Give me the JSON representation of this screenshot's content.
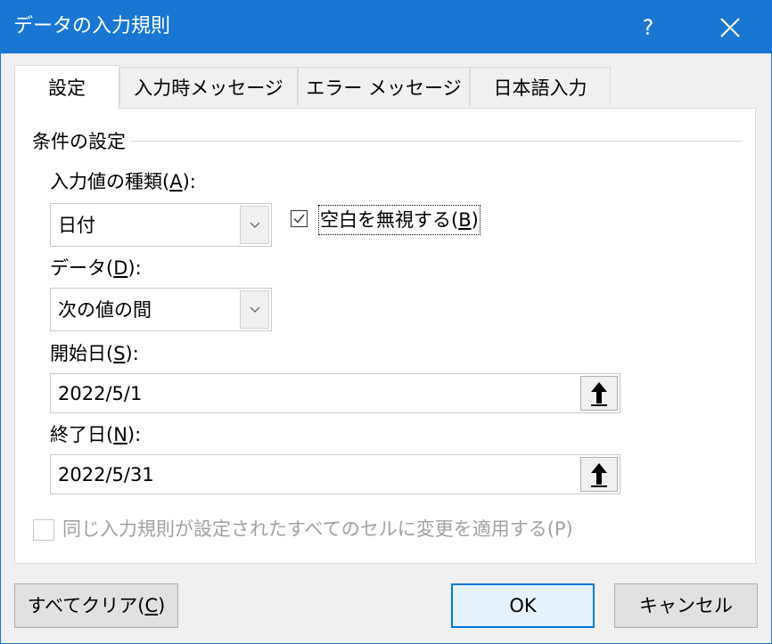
{
  "window": {
    "title": "データの入力規則",
    "help_label": "?"
  },
  "tabs": [
    {
      "label": "設定",
      "active": true
    },
    {
      "label": "入力時メッセージ",
      "active": false
    },
    {
      "label": "エラー メッセージ",
      "active": false
    },
    {
      "label": "日本語入力",
      "active": false
    }
  ],
  "conditions": {
    "group_title": "条件の設定",
    "allow": {
      "label_prefix": "入力値の種類(",
      "label_key": "A",
      "label_suffix": "):",
      "value": "日付"
    },
    "ignore_blank": {
      "label_prefix": "空白を無視する(",
      "label_key": "B",
      "label_suffix": ")",
      "checked": true
    },
    "data": {
      "label_prefix": "データ(",
      "label_key": "D",
      "label_suffix": "):",
      "value": "次の値の間"
    },
    "start_date": {
      "label_prefix": "開始日(",
      "label_key": "S",
      "label_suffix": "):",
      "value": "2022/5/1"
    },
    "end_date": {
      "label_prefix": "終了日(",
      "label_key": "N",
      "label_suffix": "):",
      "value": "2022/5/31"
    },
    "apply_all": {
      "label": "同じ入力規則が設定されたすべてのセルに変更を適用する(P)",
      "checked": false,
      "disabled": true
    }
  },
  "buttons": {
    "clear_all_prefix": "すべてクリア(",
    "clear_all_key": "C",
    "clear_all_suffix": ")",
    "ok": "OK",
    "cancel": "キャンセル"
  },
  "colors": {
    "titlebar": "#1976d2",
    "default_button_border": "#0078d7",
    "disabled_text": "#a0a0a0"
  }
}
